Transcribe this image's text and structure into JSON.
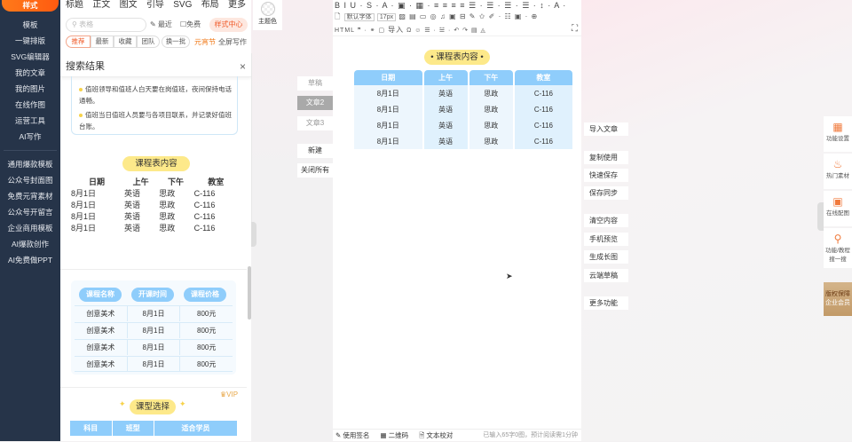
{
  "sidebar": {
    "active": "样式",
    "items": [
      "模板",
      "一键排版",
      "SVG编辑器",
      "我的文章",
      "我的图片",
      "在线作图",
      "运营工具",
      "AI写作"
    ],
    "items2": [
      "通用爆款模板",
      "公众号封面图",
      "免费元宵素材",
      "公众号开留言",
      "企业商用模板",
      "AI爆款创作",
      "AI免费做PPT"
    ]
  },
  "panel": {
    "tabs": [
      "标题",
      "正文",
      "图文",
      "引导",
      "SVG",
      "布局",
      "更多"
    ],
    "search_placeholder": "表格",
    "recent": "最近",
    "free": "免费",
    "style_center": "样式中心",
    "chips": [
      "推荐",
      "最新",
      "收藏",
      "团队"
    ],
    "swap": "换一批",
    "festival": "元宵节",
    "fullscreen": "全屏写作",
    "results_title": "搜索结果",
    "close": "×",
    "notice": [
      "值班领导和值班人白天要在岗值班，夜间保持电话通畅。",
      "值班当日值班人员要与各项目联系，并记录好值班台账。"
    ],
    "schedule": {
      "title": "课程表内容",
      "headers": [
        "日期",
        "上午",
        "下午",
        "教室"
      ],
      "rows": [
        [
          "8月1日",
          "英语",
          "思政",
          "C-116"
        ],
        [
          "8月1日",
          "英语",
          "思政",
          "C-116"
        ],
        [
          "8月1日",
          "英语",
          "思政",
          "C-116"
        ],
        [
          "8月1日",
          "英语",
          "思政",
          "C-116"
        ]
      ]
    },
    "courses": {
      "headers": [
        "课程名称",
        "开课时间",
        "课程价格"
      ],
      "rows": [
        [
          "创意美术",
          "8月1日",
          "800元"
        ],
        [
          "创意美术",
          "8月1日",
          "800元"
        ],
        [
          "创意美术",
          "8月1日",
          "800元"
        ],
        [
          "创意美术",
          "8月1日",
          "800元"
        ]
      ]
    },
    "vip": "VIP",
    "type_select": {
      "title": "课型选择",
      "headers": [
        "科目",
        "班型",
        "适合学员"
      ]
    }
  },
  "col2": {
    "theme": "主题色",
    "tabs": [
      "草稿",
      "文章2",
      "文章3"
    ],
    "new": "新建",
    "close_all": "关闭所有"
  },
  "editor": {
    "toolbar1": "B I U · S · A · ▣ · ▦ · ≡ ≡ ≡ ≡ ☰ · ☰ · ☰ · ☰ · ↕ · A ·",
    "font": "默认字体",
    "size": "17px",
    "toolbar2": "▨ ▤ ▭ ◎ ♫ ▣ ⊟ ✎ ✩ ✐ · ☷ ▣ · ⊕",
    "toolbar3a": "HTML ❞ · ⚭ ▢",
    "import": "导入",
    "toolbar3b": "Ω ☺ ☰ · ☱ · ↶ ↷ ▤ ◬",
    "schedule": {
      "title": "课程表内容",
      "headers": [
        "日期",
        "上午",
        "下午",
        "教室"
      ],
      "rows": [
        [
          "8月1日",
          "英语",
          "思政",
          "C-116"
        ],
        [
          "8月1日",
          "英语",
          "思政",
          "C-116"
        ],
        [
          "8月1日",
          "英语",
          "思政",
          "C-116"
        ],
        [
          "8月1日",
          "英语",
          "思政",
          "C-116"
        ]
      ]
    },
    "status": {
      "signature": "使用签名",
      "qrcode": "二维码",
      "proofread": "文本校对",
      "count": "已输入65字0图，预计阅读需1分钟"
    }
  },
  "actions": [
    "导入文章",
    "复制使用",
    "快速保存",
    "保存同步",
    "清空内容",
    "手机预览",
    "生成长图",
    "云端草稿",
    "更多功能"
  ],
  "rail": {
    "items": [
      "功能设置",
      "热门素材",
      "在线配图",
      "功能/教程搜一搜"
    ],
    "vip1": "版权保障",
    "vip2": "企业会员"
  }
}
